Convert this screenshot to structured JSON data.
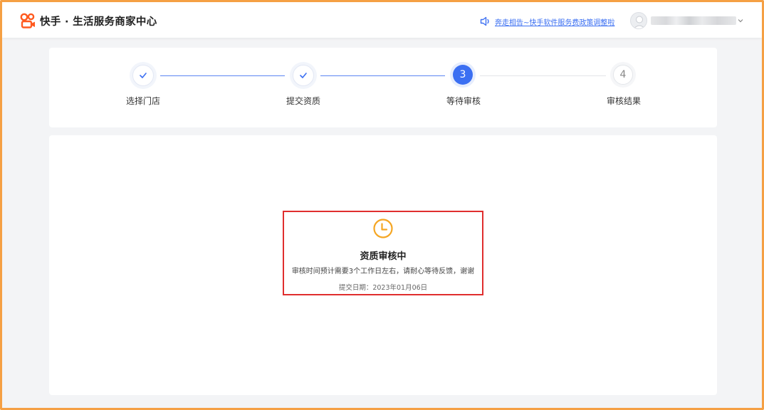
{
  "header": {
    "title": "快手 · 生活服务商家中心",
    "notice": "奔走相告~快手软件服务费政策调整啦",
    "logo_icon": "kuaishou-logo",
    "notice_icon": "speaker-icon",
    "user_chevron_icon": "chevron-down-icon"
  },
  "steps": [
    {
      "label": "选择门店",
      "status": "done",
      "mark": "✓"
    },
    {
      "label": "提交资质",
      "status": "done",
      "mark": "✓"
    },
    {
      "label": "等待审核",
      "status": "active",
      "mark": "3"
    },
    {
      "label": "审核结果",
      "status": "todo",
      "mark": "4"
    }
  ],
  "review": {
    "icon": "clock-icon",
    "title": "资质审核中",
    "description": "审核时间预计需要3个工作日左右，请耐心等待反馈，谢谢",
    "submit_date": "提交日期：2023年01月06日"
  },
  "colors": {
    "accent": "#3b6ff2",
    "logo": "#ff5a1f",
    "clock": "#f5a623",
    "highlight": "#e02e2e",
    "frame": "#f5a044"
  }
}
